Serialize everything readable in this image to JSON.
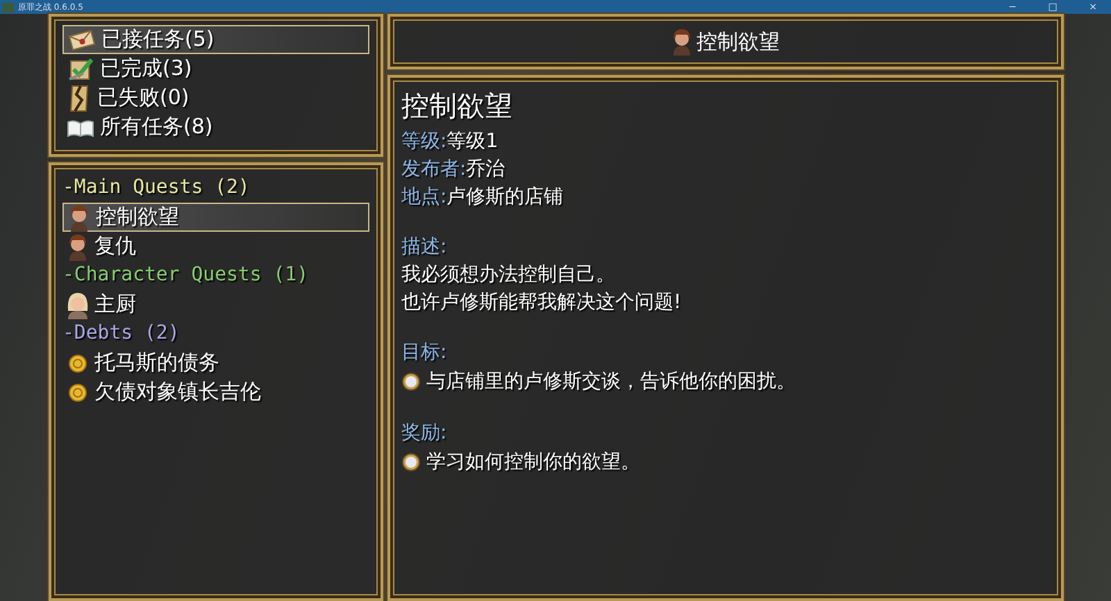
{
  "window": {
    "title": "原罪之战 0.6.0.5",
    "controls": [
      "−",
      "□",
      "×"
    ]
  },
  "filters": [
    {
      "label": "已接任务(5)",
      "kind": "letter",
      "selected": true
    },
    {
      "label": "已完成(3)",
      "kind": "check",
      "selected": false
    },
    {
      "label": "已失败(0)",
      "kind": "torn",
      "selected": false
    },
    {
      "label": "所有任务(8)",
      "kind": "book",
      "selected": false
    }
  ],
  "categories": [
    {
      "label": "-Main Quests (2)",
      "color": "#e4e6a0",
      "items": [
        {
          "label": "控制欲望",
          "kind": "male",
          "selected": true
        },
        {
          "label": "复仇",
          "kind": "male",
          "selected": false
        }
      ]
    },
    {
      "label": "-Character Quests (1)",
      "color": "#86cc6e",
      "items": [
        {
          "label": "主厨",
          "kind": "female",
          "selected": false
        }
      ]
    },
    {
      "label": "-Debts (2)",
      "color": "#a9a6e6",
      "items": [
        {
          "label": "托马斯的债务",
          "kind": "coin",
          "selected": false
        },
        {
          "label": "欠债对象镇长吉伦",
          "kind": "coin",
          "selected": false
        }
      ]
    }
  ],
  "header": {
    "title": "控制欲望",
    "kind": "male"
  },
  "detail": {
    "title": "控制欲望",
    "fields": [
      {
        "label": "等级:",
        "value": "等级1"
      },
      {
        "label": "发布者:",
        "value": "乔治"
      },
      {
        "label": "地点:",
        "value": "卢修斯的店铺"
      }
    ],
    "sections": [
      {
        "kind": "text",
        "label": "描述:",
        "lines": [
          "我必须想办法控制自己。",
          "也许卢修斯能帮我解决这个问题!"
        ]
      },
      {
        "kind": "bullets",
        "label": "目标:",
        "lines": [
          "与店铺里的卢修斯交谈，告诉他你的困扰。"
        ]
      },
      {
        "kind": "bullets",
        "label": "奖励:",
        "lines": [
          "学习如何控制你的欲望。"
        ]
      }
    ]
  }
}
